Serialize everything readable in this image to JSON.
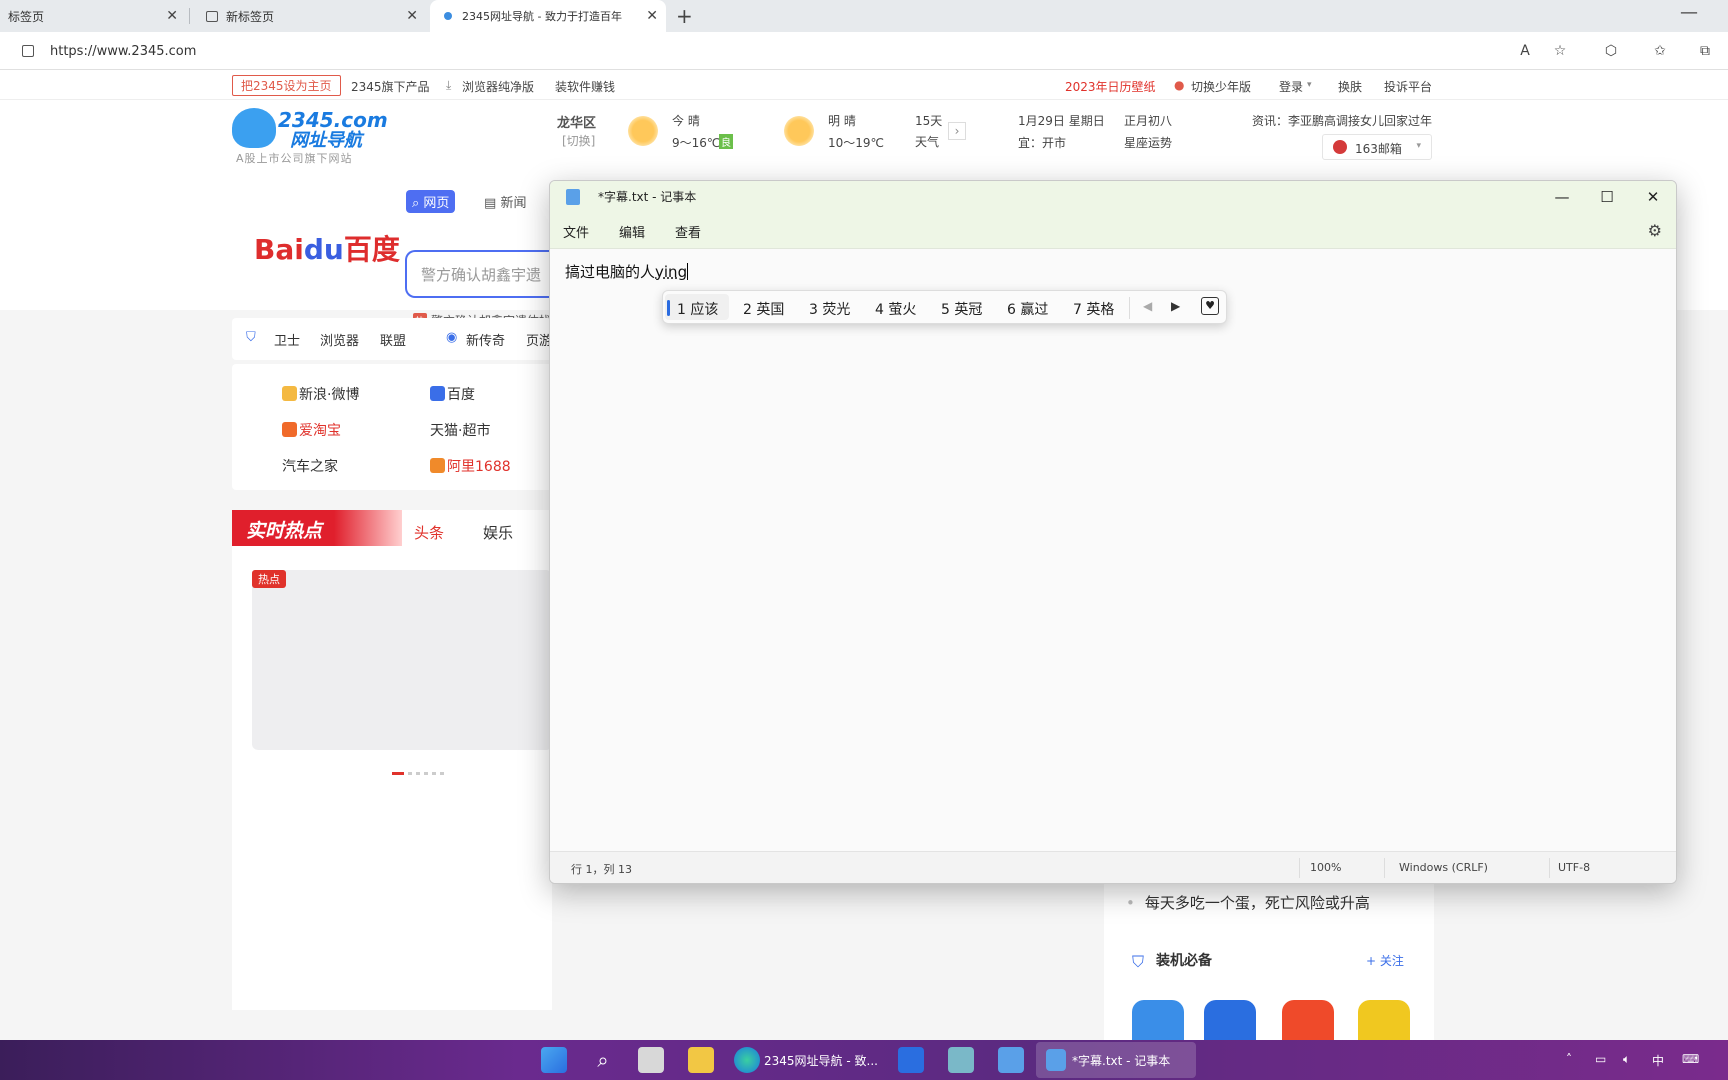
{
  "browser": {
    "tabs": [
      {
        "title": "标签页"
      },
      {
        "title": "新标签页"
      },
      {
        "title": "2345网址导航 - 致力于打造百年"
      }
    ],
    "url": "https://www.2345.com"
  },
  "page": {
    "topline": {
      "set_home": "把2345设为主页",
      "products": "2345旗下产品",
      "browser_clean": "浏览器纯净版",
      "install_earn": "装软件赚钱",
      "calendar_wall": "2023年日历壁纸",
      "youth_mode": "切换少年版",
      "login": "登录",
      "skin": "换肤",
      "complaint": "投诉平台"
    },
    "logo": {
      "brand": "2345.com",
      "name": "网址导航",
      "subtitle": "A股上市公司旗下网站"
    },
    "weather": {
      "district": "龙华区",
      "switch": "[切换]",
      "today_label": "今  晴",
      "today_temp": "9～16℃",
      "aqi": "良",
      "tomorrow_label": "明  晴",
      "tomorrow_temp": "10～19℃",
      "days15": "15天",
      "weather_word": "天气"
    },
    "calendar": {
      "date": "1月29日 星期日",
      "lunar": "正月初八",
      "yi": "宜：开市",
      "horoscope": "星座运势"
    },
    "news_ticker": "资讯：李亚鹏高调接女儿回家过年",
    "mail": "163邮箱",
    "search": {
      "tab_web": "网页",
      "tab_news": "新闻",
      "placeholder": "警方确认胡鑫宇遗",
      "hot": "警方确认胡鑫宇遗体找"
    },
    "navbar": [
      "卫士",
      "浏览器",
      "联盟",
      "新传奇",
      "页游"
    ],
    "links": [
      {
        "label": "新浪·微博"
      },
      {
        "label": "百度"
      },
      {
        "label": "爱淘宝"
      },
      {
        "label": "天猫·超市"
      },
      {
        "label": "汽车之家"
      },
      {
        "label": "阿里1688"
      }
    ],
    "hot": {
      "banner": "实时热点",
      "tab_headline": "头条",
      "tab_ent": "娱乐",
      "badge": "热点"
    },
    "right": {
      "news": "每天多吃一个蛋，死亡风险或升高",
      "install_title": "装机必备",
      "follow": "+ 关注"
    }
  },
  "notepad": {
    "title": "*字幕.txt - 记事本",
    "menu": [
      "文件",
      "编辑",
      "查看"
    ],
    "text_committed": "搞过电脑的人",
    "text_preedit": "ying",
    "status": {
      "position": "行 1，列 13",
      "zoom": "100%",
      "eol": "Windows (CRLF)",
      "encoding": "UTF-8"
    }
  },
  "ime": {
    "candidates": [
      "1 应该",
      "2 英国",
      "3 荧光",
      "4 萤火",
      "5 英冠",
      "6 赢过",
      "7 英格"
    ]
  },
  "taskbar": {
    "edge_label": "2345网址导航 - 致...",
    "notepad_label": "*字幕.txt - 记事本",
    "tray_ime": "中"
  }
}
